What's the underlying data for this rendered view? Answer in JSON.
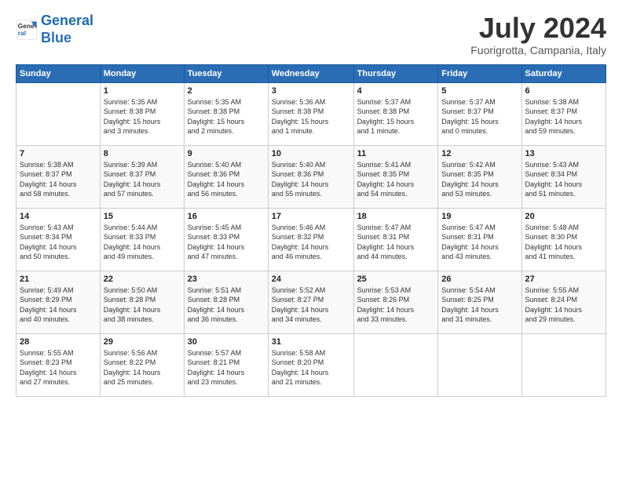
{
  "logo": {
    "line1": "General",
    "line2": "Blue"
  },
  "title": "July 2024",
  "location": "Fuorigrotta, Campania, Italy",
  "header_days": [
    "Sunday",
    "Monday",
    "Tuesday",
    "Wednesday",
    "Thursday",
    "Friday",
    "Saturday"
  ],
  "weeks": [
    [
      {
        "num": "",
        "info": ""
      },
      {
        "num": "1",
        "info": "Sunrise: 5:35 AM\nSunset: 8:38 PM\nDaylight: 15 hours\nand 3 minutes."
      },
      {
        "num": "2",
        "info": "Sunrise: 5:35 AM\nSunset: 8:38 PM\nDaylight: 15 hours\nand 2 minutes."
      },
      {
        "num": "3",
        "info": "Sunrise: 5:36 AM\nSunset: 8:38 PM\nDaylight: 15 hours\nand 1 minute."
      },
      {
        "num": "4",
        "info": "Sunrise: 5:37 AM\nSunset: 8:38 PM\nDaylight: 15 hours\nand 1 minute."
      },
      {
        "num": "5",
        "info": "Sunrise: 5:37 AM\nSunset: 8:37 PM\nDaylight: 15 hours\nand 0 minutes."
      },
      {
        "num": "6",
        "info": "Sunrise: 5:38 AM\nSunset: 8:37 PM\nDaylight: 14 hours\nand 59 minutes."
      }
    ],
    [
      {
        "num": "7",
        "info": "Sunrise: 5:38 AM\nSunset: 8:37 PM\nDaylight: 14 hours\nand 58 minutes."
      },
      {
        "num": "8",
        "info": "Sunrise: 5:39 AM\nSunset: 8:37 PM\nDaylight: 14 hours\nand 57 minutes."
      },
      {
        "num": "9",
        "info": "Sunrise: 5:40 AM\nSunset: 8:36 PM\nDaylight: 14 hours\nand 56 minutes."
      },
      {
        "num": "10",
        "info": "Sunrise: 5:40 AM\nSunset: 8:36 PM\nDaylight: 14 hours\nand 55 minutes."
      },
      {
        "num": "11",
        "info": "Sunrise: 5:41 AM\nSunset: 8:35 PM\nDaylight: 14 hours\nand 54 minutes."
      },
      {
        "num": "12",
        "info": "Sunrise: 5:42 AM\nSunset: 8:35 PM\nDaylight: 14 hours\nand 53 minutes."
      },
      {
        "num": "13",
        "info": "Sunrise: 5:43 AM\nSunset: 8:34 PM\nDaylight: 14 hours\nand 51 minutes."
      }
    ],
    [
      {
        "num": "14",
        "info": "Sunrise: 5:43 AM\nSunset: 8:34 PM\nDaylight: 14 hours\nand 50 minutes."
      },
      {
        "num": "15",
        "info": "Sunrise: 5:44 AM\nSunset: 8:33 PM\nDaylight: 14 hours\nand 49 minutes."
      },
      {
        "num": "16",
        "info": "Sunrise: 5:45 AM\nSunset: 8:33 PM\nDaylight: 14 hours\nand 47 minutes."
      },
      {
        "num": "17",
        "info": "Sunrise: 5:46 AM\nSunset: 8:32 PM\nDaylight: 14 hours\nand 46 minutes."
      },
      {
        "num": "18",
        "info": "Sunrise: 5:47 AM\nSunset: 8:31 PM\nDaylight: 14 hours\nand 44 minutes."
      },
      {
        "num": "19",
        "info": "Sunrise: 5:47 AM\nSunset: 8:31 PM\nDaylight: 14 hours\nand 43 minutes."
      },
      {
        "num": "20",
        "info": "Sunrise: 5:48 AM\nSunset: 8:30 PM\nDaylight: 14 hours\nand 41 minutes."
      }
    ],
    [
      {
        "num": "21",
        "info": "Sunrise: 5:49 AM\nSunset: 8:29 PM\nDaylight: 14 hours\nand 40 minutes."
      },
      {
        "num": "22",
        "info": "Sunrise: 5:50 AM\nSunset: 8:28 PM\nDaylight: 14 hours\nand 38 minutes."
      },
      {
        "num": "23",
        "info": "Sunrise: 5:51 AM\nSunset: 8:28 PM\nDaylight: 14 hours\nand 36 minutes."
      },
      {
        "num": "24",
        "info": "Sunrise: 5:52 AM\nSunset: 8:27 PM\nDaylight: 14 hours\nand 34 minutes."
      },
      {
        "num": "25",
        "info": "Sunrise: 5:53 AM\nSunset: 8:26 PM\nDaylight: 14 hours\nand 33 minutes."
      },
      {
        "num": "26",
        "info": "Sunrise: 5:54 AM\nSunset: 8:25 PM\nDaylight: 14 hours\nand 31 minutes."
      },
      {
        "num": "27",
        "info": "Sunrise: 5:55 AM\nSunset: 8:24 PM\nDaylight: 14 hours\nand 29 minutes."
      }
    ],
    [
      {
        "num": "28",
        "info": "Sunrise: 5:55 AM\nSunset: 8:23 PM\nDaylight: 14 hours\nand 27 minutes."
      },
      {
        "num": "29",
        "info": "Sunrise: 5:56 AM\nSunset: 8:22 PM\nDaylight: 14 hours\nand 25 minutes."
      },
      {
        "num": "30",
        "info": "Sunrise: 5:57 AM\nSunset: 8:21 PM\nDaylight: 14 hours\nand 23 minutes."
      },
      {
        "num": "31",
        "info": "Sunrise: 5:58 AM\nSunset: 8:20 PM\nDaylight: 14 hours\nand 21 minutes."
      },
      {
        "num": "",
        "info": ""
      },
      {
        "num": "",
        "info": ""
      },
      {
        "num": "",
        "info": ""
      }
    ]
  ]
}
